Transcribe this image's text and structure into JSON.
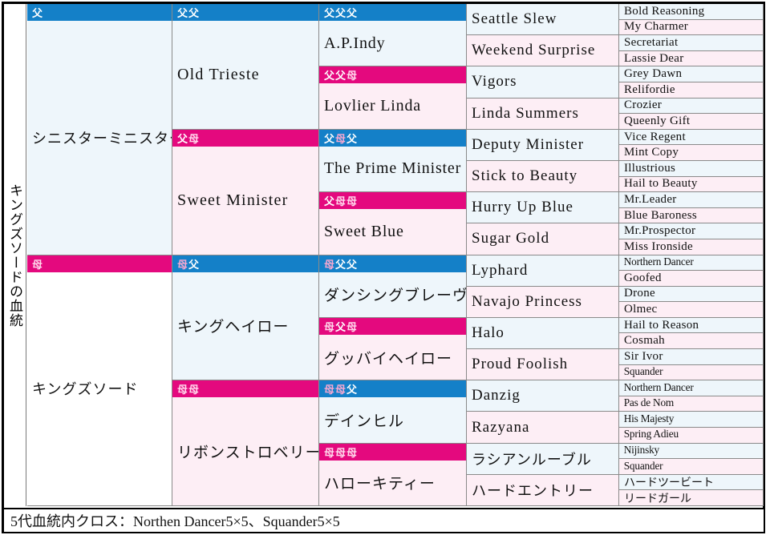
{
  "title": "キングズソードの血統",
  "footer": "5代血統内クロス：Northen Dancer5×5、Squander5×5",
  "labels": {
    "sire": "父",
    "dam": "母",
    "sire_sire": "父父",
    "sire_dam": "父母",
    "dam_sire": "母父",
    "dam_dam": "母母",
    "sire_sire_sire": "父父父",
    "sire_sire_dam": "父父母",
    "sire_dam_sire": "父母父",
    "sire_dam_dam": "父母母",
    "dam_sire_sire": "母父父",
    "dam_sire_dam": "母父母",
    "dam_dam_sire": "母母父",
    "dam_dam_dam": "母母母"
  },
  "gen1": [
    {
      "name": "シニスターミニスター",
      "type": "sire"
    },
    {
      "name": "キングズソード",
      "type": "dam"
    }
  ],
  "gen2": [
    {
      "name": "Old Trieste",
      "type": "sire"
    },
    {
      "name": "Sweet Minister",
      "type": "dam"
    },
    {
      "name": "キングヘイロー",
      "type": "sire"
    },
    {
      "name": "リボンストロベリー",
      "type": "dam"
    }
  ],
  "gen3": [
    {
      "name": "A.P.Indy",
      "type": "sire"
    },
    {
      "name": "Lovlier Linda",
      "type": "dam"
    },
    {
      "name": "The Prime Minister",
      "type": "sire"
    },
    {
      "name": "Sweet Blue",
      "type": "dam"
    },
    {
      "name": "ダンシングブレーヴ",
      "type": "sire"
    },
    {
      "name": "グッバイヘイロー",
      "type": "dam"
    },
    {
      "name": "デインヒル",
      "type": "sire"
    },
    {
      "name": "ハローキティー",
      "type": "dam"
    }
  ],
  "gen4": [
    {
      "name": "Seattle Slew",
      "type": "sire"
    },
    {
      "name": "Weekend Surprise",
      "type": "dam"
    },
    {
      "name": "Vigors",
      "type": "sire"
    },
    {
      "name": "Linda Summers",
      "type": "dam"
    },
    {
      "name": "Deputy Minister",
      "type": "sire"
    },
    {
      "name": "Stick to Beauty",
      "type": "dam"
    },
    {
      "name": "Hurry Up Blue",
      "type": "sire"
    },
    {
      "name": "Sugar Gold",
      "type": "dam"
    },
    {
      "name": "Lyphard",
      "type": "sire"
    },
    {
      "name": "Navajo Princess",
      "type": "dam"
    },
    {
      "name": "Halo",
      "type": "sire"
    },
    {
      "name": "Proud Foolish",
      "type": "dam"
    },
    {
      "name": "Danzig",
      "type": "sire"
    },
    {
      "name": "Razyana",
      "type": "dam"
    },
    {
      "name": "ラシアンルーブル",
      "type": "sire"
    },
    {
      "name": "ハードエントリー",
      "type": "dam"
    }
  ],
  "gen5": [
    {
      "name": "Bold Reasoning",
      "type": "sire"
    },
    {
      "name": "My Charmer",
      "type": "dam"
    },
    {
      "name": "Secretariat",
      "type": "sire"
    },
    {
      "name": "Lassie Dear",
      "type": "dam"
    },
    {
      "name": "Grey Dawn",
      "type": "sire"
    },
    {
      "name": "Relifordie",
      "type": "dam"
    },
    {
      "name": "Crozier",
      "type": "sire"
    },
    {
      "name": "Queenly Gift",
      "type": "dam"
    },
    {
      "name": "Vice Regent",
      "type": "sire"
    },
    {
      "name": "Mint Copy",
      "type": "dam"
    },
    {
      "name": "Illustrious",
      "type": "sire"
    },
    {
      "name": "Hail to Beauty",
      "type": "dam"
    },
    {
      "name": "Mr.Leader",
      "type": "sire"
    },
    {
      "name": "Blue Baroness",
      "type": "dam"
    },
    {
      "name": "Mr.Prospector",
      "type": "sire"
    },
    {
      "name": "Miss Ironside",
      "type": "dam"
    },
    {
      "name": "Northern Dancer",
      "type": "sire"
    },
    {
      "name": "Goofed",
      "type": "dam"
    },
    {
      "name": "Drone",
      "type": "sire"
    },
    {
      "name": "Olmec",
      "type": "dam"
    },
    {
      "name": "Hail to Reason",
      "type": "sire"
    },
    {
      "name": "Cosmah",
      "type": "dam"
    },
    {
      "name": "Sir Ivor",
      "type": "sire"
    },
    {
      "name": "Squander",
      "type": "dam"
    },
    {
      "name": "Northern Dancer",
      "type": "sire"
    },
    {
      "name": "Pas de Nom",
      "type": "dam"
    },
    {
      "name": "His Majesty",
      "type": "sire"
    },
    {
      "name": "Spring Adieu",
      "type": "dam"
    },
    {
      "name": "Nijinsky",
      "type": "sire"
    },
    {
      "name": "Squander",
      "type": "dam"
    },
    {
      "name": "ハードツービート",
      "type": "sire"
    },
    {
      "name": "リードガール",
      "type": "dam"
    }
  ],
  "colors": {
    "sire_label_bg": "#1480c8",
    "dam_label_bg": "#e4097e",
    "sire_cell_bg": "#eef6fb",
    "dam_cell_bg": "#fdeef5"
  }
}
